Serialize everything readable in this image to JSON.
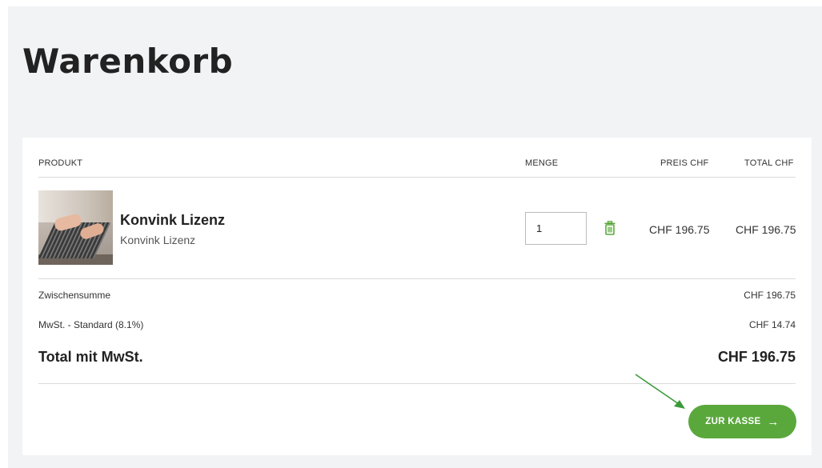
{
  "page": {
    "title": "Warenkorb"
  },
  "table": {
    "headers": {
      "product": "PRODUKT",
      "quantity": "MENGE",
      "price": "PREIS CHF",
      "total": "TOTAL CHF"
    },
    "items": [
      {
        "name": "Konvink Lizenz",
        "subtitle": "Konvink Lizenz",
        "quantity": "1",
        "price": "CHF 196.75",
        "total": "CHF 196.75"
      }
    ]
  },
  "summary": {
    "subtotal_label": "Zwischensumme",
    "subtotal_value": "CHF 196.75",
    "vat_label": "MwSt. - Standard (8.1%)",
    "vat_value": "CHF 14.74",
    "total_label": "Total mit MwSt.",
    "total_value": "CHF 196.75"
  },
  "actions": {
    "checkout_label": "ZUR KASSE",
    "checkout_arrow": "→"
  },
  "icons": {
    "delete": "trash-icon",
    "annotation": "arrow-annotation"
  },
  "colors": {
    "accent": "#5aa83c",
    "background": "#f2f3f5"
  }
}
